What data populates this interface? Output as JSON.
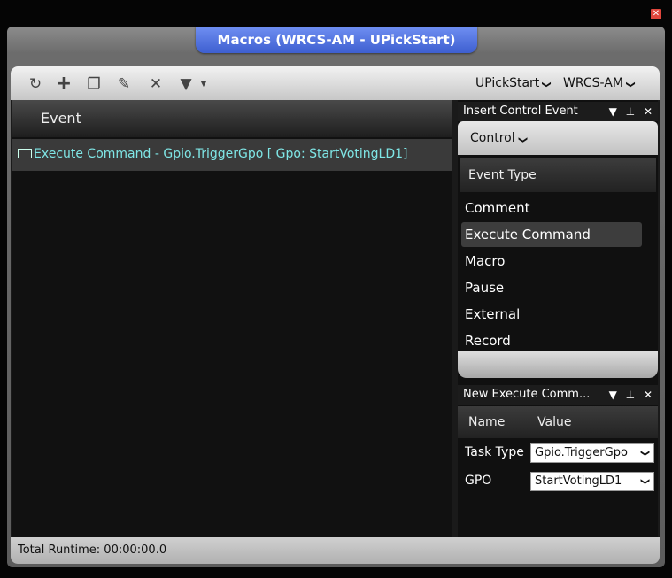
{
  "window": {
    "title": "Macros (WRCS-AM - UPickStart)",
    "close_glyph": "✕"
  },
  "toolbar": {
    "icons": {
      "refresh": "↻",
      "add": "+",
      "copy": "❐",
      "edit": "✎",
      "delete": "✕",
      "filter": "▼"
    },
    "macro_select": "UPickStart",
    "station_select": "WRCS-AM"
  },
  "event_list": {
    "header": "Event",
    "rows": [
      "Execute Command - Gpio.TriggerGpo [ Gpo: StartVotingLD1]"
    ]
  },
  "insert_pane": {
    "title": "Insert Control Event",
    "category": "Control",
    "column_header": "Event Type",
    "items": [
      "Comment",
      "Execute Command",
      "Macro",
      "Pause",
      "External",
      "Record"
    ],
    "selected": "Execute Command"
  },
  "props_pane": {
    "title": "New Execute Comm...",
    "col_name": "Name",
    "col_value": "Value",
    "task_type_label": "Task Type",
    "task_type_value": "Gpio.TriggerGpo",
    "gpo_label": "GPO",
    "gpo_value": "StartVotingLD1"
  },
  "status": {
    "runtime": "Total Runtime: 00:00:00.0"
  },
  "colors": {
    "title_tab": "#4f6fe0",
    "row_text": "#7fe6e6"
  }
}
